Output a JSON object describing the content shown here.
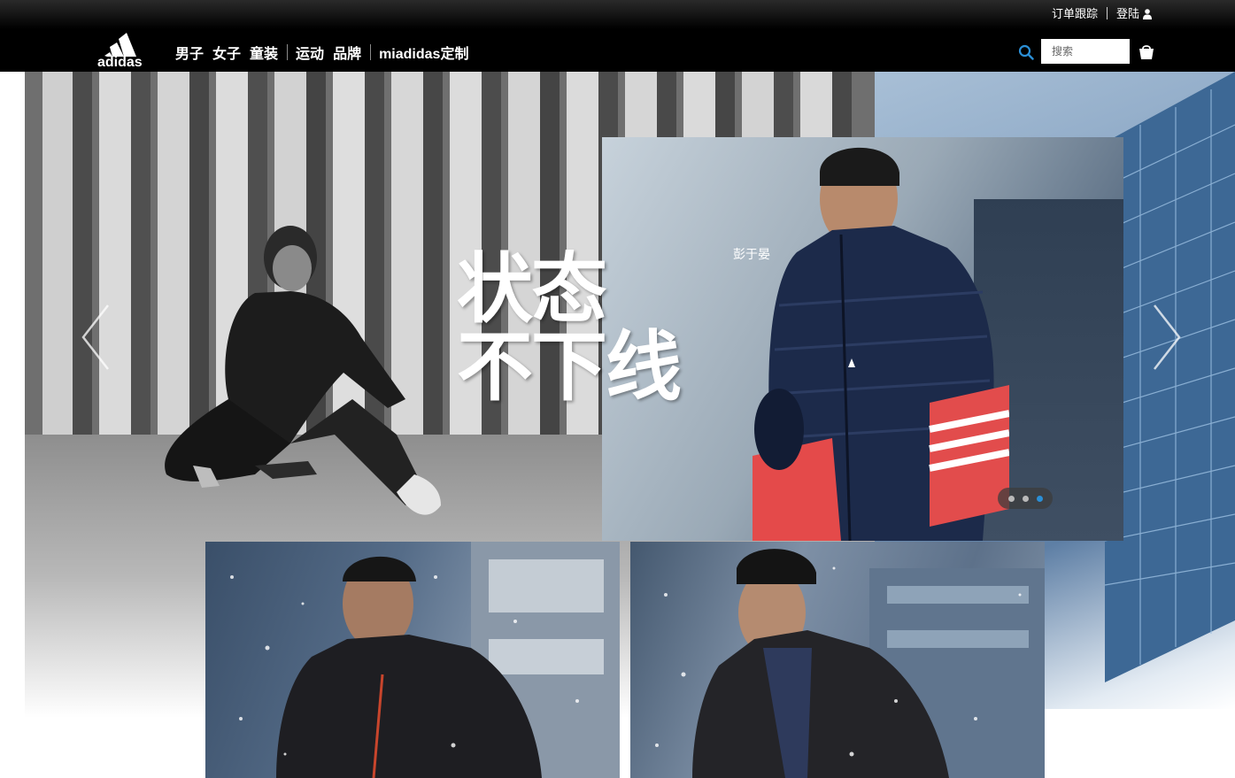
{
  "utility_bar": {
    "order_tracking": "订单跟踪",
    "login": "登陆",
    "user_icon": "user-icon"
  },
  "nav": {
    "logo_text": "adidas",
    "items": [
      "男子",
      "女子",
      "童装",
      "运动",
      "品牌",
      "miadidas定制"
    ],
    "search_placeholder": "搜索",
    "search_icon": "search-icon",
    "bag_icon": "shopping-bag-icon",
    "accent_color": "#2b8fd6"
  },
  "hero": {
    "headline_line1": "状态",
    "headline_line2": "不下线",
    "caption": "彭于晏",
    "carousel_dots": 3,
    "active_dot": 3
  }
}
